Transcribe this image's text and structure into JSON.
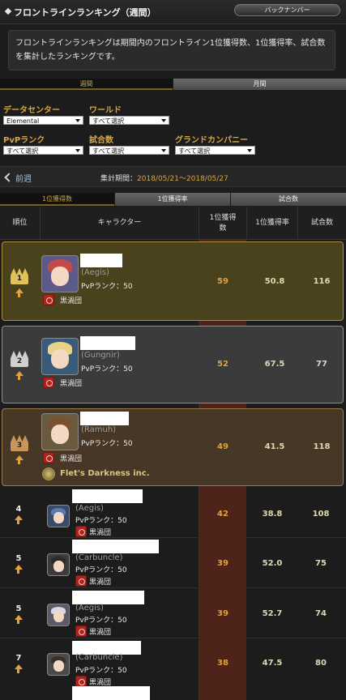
{
  "header": {
    "title": "フロントラインランキング（週間）",
    "back_button": "バックナンバー"
  },
  "description": "フロントラインランキングは期間内のフロントライン1位獲得数、1位獲得率、試合数を集計したランキングです。",
  "period_tabs": {
    "weekly": "週間",
    "monthly": "月間"
  },
  "filters": {
    "datacenter_label": "データセンター",
    "datacenter_value": "Elemental",
    "world_label": "ワールド",
    "world_value": "すべて選択",
    "pvprank_label": "PvPランク",
    "pvprank_value": "すべて選択",
    "matches_label": "試合数",
    "matches_value": "すべて選択",
    "gc_label": "グランドカンパニー",
    "gc_value": "すべて選択"
  },
  "nav": {
    "prev_label": "前週",
    "period_prefix": "集計期間：",
    "period_dates": "2018/05/21〜2018/05/27"
  },
  "sort_tabs": [
    "1位獲得数",
    "1位獲得率",
    "試合数"
  ],
  "columns": {
    "rank": "順位",
    "character": "キャラクター",
    "first": "1位獲得数",
    "rate": "1位獲得率",
    "matches": "試合数"
  },
  "colors": {
    "accent": "#d7a642",
    "highlight_column": "#6a2a1c",
    "gold": "#a58e3c",
    "silver": "#8d8d8d",
    "bronze": "#9c7a4a"
  },
  "rows": [
    {
      "rank": "1",
      "world": "(Aegis)",
      "pvp_rank": "PvPランク：50",
      "gc": "黒渦団",
      "first": "59",
      "rate": "50.8",
      "matches": "116"
    },
    {
      "rank": "2",
      "world": "(Gungnir)",
      "pvp_rank": "PvPランク：50",
      "gc": "黒渦団",
      "first": "52",
      "rate": "67.5",
      "matches": "77"
    },
    {
      "rank": "3",
      "world": "(Ramuh)",
      "pvp_rank": "PvPランク：50",
      "gc": "黒渦団",
      "fc": "Flet's Darkness inc.",
      "first": "49",
      "rate": "41.5",
      "matches": "118"
    },
    {
      "rank": "4",
      "world": "(Aegis)",
      "pvp_rank": "PvPランク：50",
      "gc": "黒渦団",
      "first": "42",
      "rate": "38.8",
      "matches": "108"
    },
    {
      "rank": "5",
      "world": "(Carbuncle)",
      "pvp_rank": "PvPランク：50",
      "gc": "黒渦団",
      "first": "39",
      "rate": "52.0",
      "matches": "75"
    },
    {
      "rank": "5",
      "world": "(Aegis)",
      "pvp_rank": "PvPランク：50",
      "gc": "黒渦団",
      "first": "39",
      "rate": "52.7",
      "matches": "74"
    },
    {
      "rank": "7",
      "world": "(Carbuncle)",
      "pvp_rank": "PvPランク：50",
      "gc": "黒渦団",
      "first": "38",
      "rate": "47.5",
      "matches": "80"
    }
  ]
}
